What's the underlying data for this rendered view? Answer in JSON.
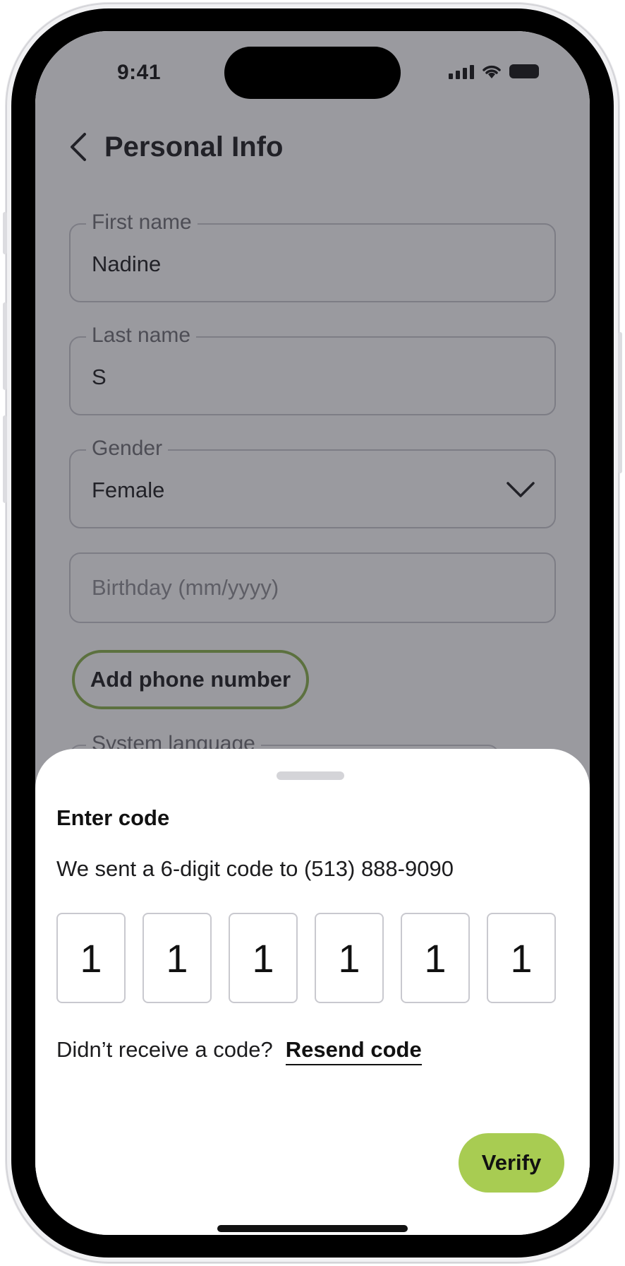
{
  "status_bar": {
    "time": "9:41"
  },
  "header": {
    "title": "Personal Info"
  },
  "form": {
    "first_name": {
      "label": "First name",
      "value": "Nadine"
    },
    "last_name": {
      "label": "Last name",
      "value": "S"
    },
    "gender": {
      "label": "Gender",
      "value": "Female"
    },
    "birthday": {
      "placeholder": "Birthday (mm/yyyy)"
    },
    "add_phone_label": "Add phone number",
    "system_language": {
      "label": "System language"
    }
  },
  "sheet": {
    "title": "Enter code",
    "description": "We sent a 6-digit code to (513) 888-9090",
    "digits": [
      "1",
      "1",
      "1",
      "1",
      "1",
      "1"
    ],
    "resend_question": "Didn’t receive a code?",
    "resend_link": "Resend code",
    "verify_label": "Verify"
  },
  "colors": {
    "accent": "#a8cc52",
    "accent_border": "#8bb24a",
    "overlay": "rgba(40,40,50,0.47)"
  }
}
